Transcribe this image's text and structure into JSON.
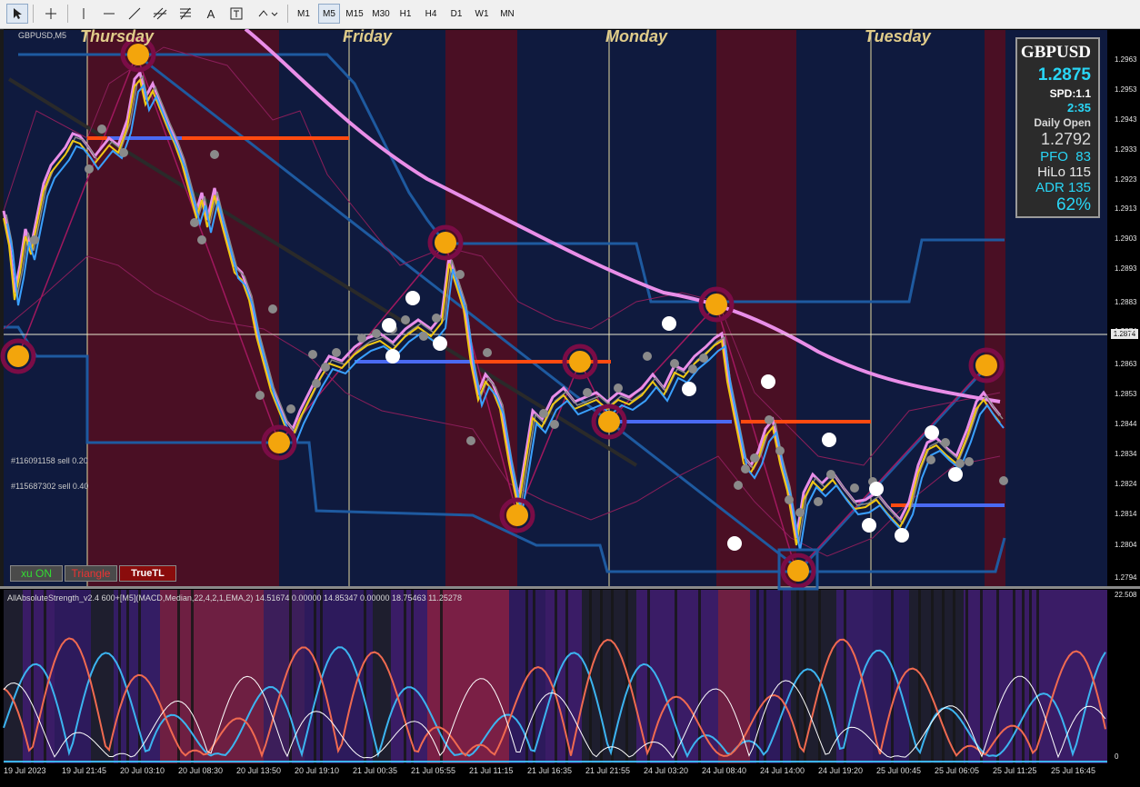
{
  "toolbar": {
    "timeframes": [
      "M1",
      "M5",
      "M15",
      "M30",
      "H1",
      "H4",
      "D1",
      "W1",
      "MN"
    ],
    "active_timeframe": "M5",
    "tools": [
      "cursor",
      "crosshair",
      "vertical-line",
      "horizontal-line",
      "trend-line",
      "fibonacci",
      "channel",
      "text",
      "label",
      "shapes"
    ],
    "text_tool": "A"
  },
  "chart": {
    "symbol_label": "GBPUSD,M5",
    "days": [
      "Thursday",
      "Friday",
      "Monday",
      "Tuesday"
    ],
    "orders": [
      "#116091158 sell 0.20",
      "#115687302 sell 0.40"
    ],
    "price_labels": [
      "1.2963",
      "1.2953",
      "1.2943",
      "1.2933",
      "1.2923",
      "1.2913",
      "1.2903",
      "1.2893",
      "1.2883",
      "1.2874",
      "1.2863",
      "1.2853",
      "1.2844",
      "1.2834",
      "1.2824",
      "1.2814",
      "1.2804",
      "1.2794"
    ],
    "current_price_tag": "1.2874",
    "time_labels": [
      "19 Jul 2023",
      "19 Jul 21:45",
      "20 Jul 03:10",
      "20 Jul 08:30",
      "20 Jul 13:50",
      "20 Jul 19:10",
      "21 Jul 00:35",
      "21 Jul 05:55",
      "21 Jul 11:15",
      "21 Jul 16:35",
      "21 Jul 21:55",
      "24 Jul 03:20",
      "24 Jul 08:40",
      "24 Jul 14:00",
      "24 Jul 19:20",
      "25 Jul 00:45",
      "25 Jul 06:05",
      "25 Jul 11:25",
      "25 Jul 16:45"
    ]
  },
  "info_panel": {
    "symbol": "GBPUSD",
    "price": "1.2875",
    "spread": "SPD:1.1",
    "timer": "2:35",
    "daily_open_label": "Daily Open",
    "daily_open": "1.2792",
    "pfo": "PFO  83",
    "hilo": "HiLo 115",
    "adr": "ADR 135",
    "pct": "62%"
  },
  "buttons": {
    "xu": "xu ON",
    "triangle": "Triangle",
    "truetl": "TrueTL"
  },
  "indicator": {
    "label": "AllAbsoluteStrength_v2.4 600+[M5](MACD,Median,22,4,2,1,EMA,2) 14.51674 0.00000 14.85347 0.00000 18.75463 11.25278",
    "scale_top": "22.508",
    "scale_bottom": "0"
  },
  "colors": {
    "bg_blue": "#0f1a3e",
    "bg_red": "#4a0f24",
    "ma_pink": "#e98ee8",
    "channel_blue": "#1e5aa0",
    "panel_cyan": "#29d6f6",
    "zigzag_orange": "#f3a50c"
  }
}
